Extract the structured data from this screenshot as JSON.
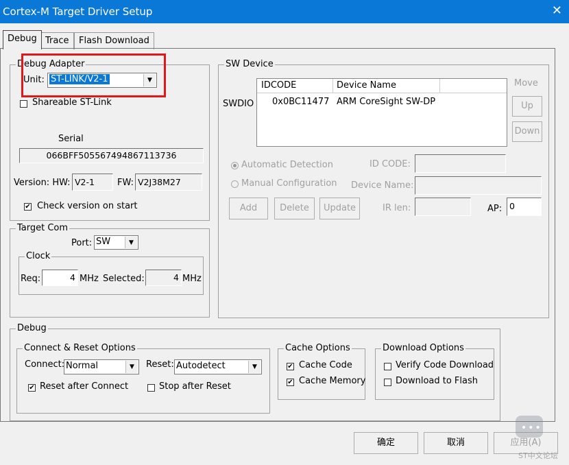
{
  "window": {
    "title": "Cortex-M Target Driver Setup",
    "close_glyph": "✕"
  },
  "tabs": [
    {
      "label": "Debug",
      "active": true
    },
    {
      "label": "Trace"
    },
    {
      "label": "Flash Download"
    }
  ],
  "debug_adapter": {
    "title": "Debug Adapter",
    "unit_label": "Unit:",
    "unit_value": "ST-LINK/V2-1",
    "shareable_label": "Shareable ST-Link",
    "shareable_checked": false,
    "serial_label": "Serial",
    "serial_value": "066BFF505567494867113736",
    "version_label": "Version: HW:",
    "hw_value": "V2-1",
    "fw_label": "FW:",
    "fw_value": "V2J38M27",
    "check_version_label": "Check version on start",
    "check_version_checked": true
  },
  "target_com": {
    "title": "Target Com",
    "port_label": "Port:",
    "port_value": "SW",
    "clock_title": "Clock",
    "req_label": "Req:",
    "req_value": "4",
    "req_unit": "MHz",
    "selected_label": "Selected:",
    "selected_value": "4",
    "selected_unit": "MHz"
  },
  "sw_device": {
    "title": "SW Device",
    "col_idcode": "IDCODE",
    "col_device_name": "Device Name",
    "row_label": "SWDIO",
    "row_idcode": "0x0BC11477",
    "row_device_name": "ARM CoreSight SW-DP",
    "move_label": "Move",
    "up_label": "Up",
    "down_label": "Down",
    "auto_detect_label": "Automatic Detection",
    "manual_config_label": "Manual Configuration",
    "id_code_label": "ID CODE:",
    "device_name_label": "Device Name:",
    "add_label": "Add",
    "delete_label": "Delete",
    "update_label": "Update",
    "ir_len_label": "IR len:",
    "ap_label": "AP:",
    "ap_value": "0"
  },
  "debug_section": {
    "title": "Debug",
    "connect_reset_title": "Connect & Reset Options",
    "connect_label": "Connect:",
    "connect_value": "Normal",
    "reset_label": "Reset:",
    "reset_value": "Autodetect",
    "reset_after_connect_label": "Reset after Connect",
    "reset_after_connect_checked": true,
    "stop_after_reset_label": "Stop after Reset",
    "stop_after_reset_checked": false,
    "cache_title": "Cache Options",
    "cache_code_label": "Cache Code",
    "cache_code_checked": true,
    "cache_memory_label": "Cache Memory",
    "cache_memory_checked": true,
    "download_title": "Download Options",
    "verify_label": "Verify Code Download",
    "verify_checked": false,
    "download_flash_label": "Download to Flash",
    "download_flash_checked": false
  },
  "footer": {
    "ok_label": "确定",
    "cancel_label": "取消",
    "apply_label": "应用(A)"
  },
  "watermark": {
    "text": "ST中文论坛"
  },
  "colors": {
    "title_bar": "#0a78d7",
    "highlight_box": "#e01818",
    "selection": "#0a78d7"
  }
}
